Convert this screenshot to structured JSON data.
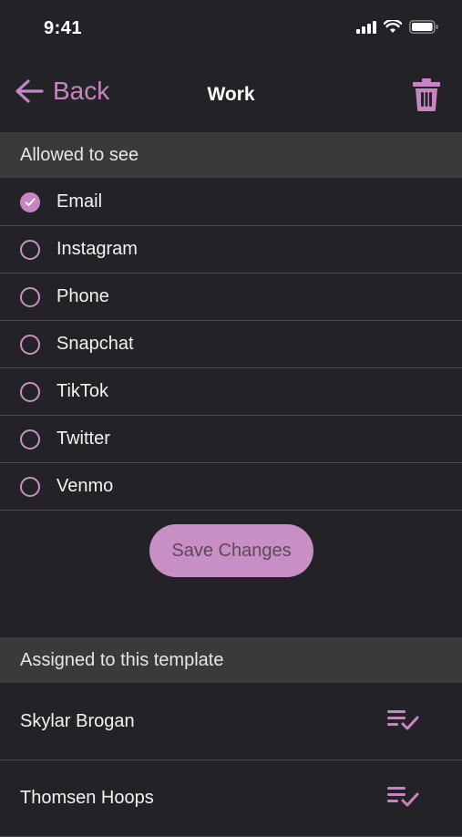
{
  "status_bar": {
    "time": "9:41"
  },
  "nav": {
    "back_label": "Back",
    "title": "Work"
  },
  "allowed_section": {
    "title": "Allowed to see"
  },
  "options": [
    {
      "label": "Email",
      "checked": true
    },
    {
      "label": "Instagram",
      "checked": false
    },
    {
      "label": "Phone",
      "checked": false
    },
    {
      "label": "Snapchat",
      "checked": false
    },
    {
      "label": "TikTok",
      "checked": false
    },
    {
      "label": "Twitter",
      "checked": false
    },
    {
      "label": "Venmo",
      "checked": false
    }
  ],
  "save_button": {
    "label": "Save Changes"
  },
  "assigned_section": {
    "title": "Assigned to this template"
  },
  "assigned_people": [
    {
      "name": "Skylar Brogan"
    },
    {
      "name": "Thomsen Hoops"
    }
  ],
  "colors": {
    "accent": "#c885c4",
    "background": "#232327",
    "header": "#3a3a3c"
  }
}
